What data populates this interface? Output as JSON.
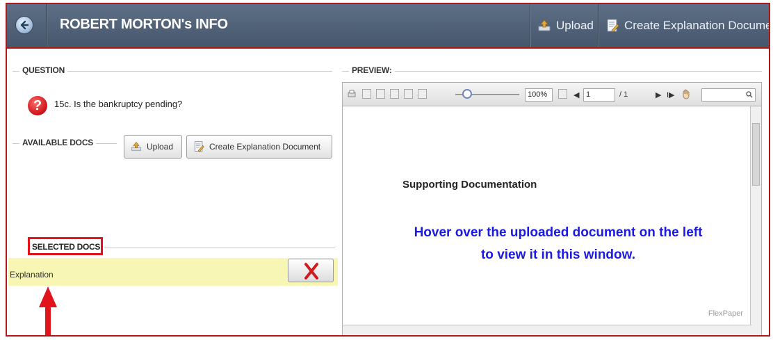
{
  "header": {
    "title": "ROBERT MORTON's INFO",
    "upload_label": "Upload",
    "create_label": "Create Explanation Document"
  },
  "question": {
    "legend": "QUESTION",
    "text": "15c. Is the bankruptcy pending?"
  },
  "available_docs": {
    "legend": "AVAILABLE DOCS",
    "upload_label": "Upload",
    "create_label": "Create Explanation Document"
  },
  "selected_docs": {
    "legend": "SELECTED DOCS",
    "items": [
      {
        "label": "Explanation"
      }
    ]
  },
  "preview": {
    "legend": "PREVIEW:",
    "toolbar": {
      "zoom": "100%",
      "page_current": "1",
      "page_total": "/ 1",
      "search_value": ""
    },
    "document": {
      "heading": "Supporting Documentation",
      "hint_line1": "Hover over the uploaded document on the left",
      "hint_line2": "to view it in this window."
    },
    "brand": "FlexPaper"
  },
  "colors": {
    "accent_red": "#e0141a",
    "hint_blue": "#1a1ae0",
    "selected_row": "#f8f6b4"
  }
}
